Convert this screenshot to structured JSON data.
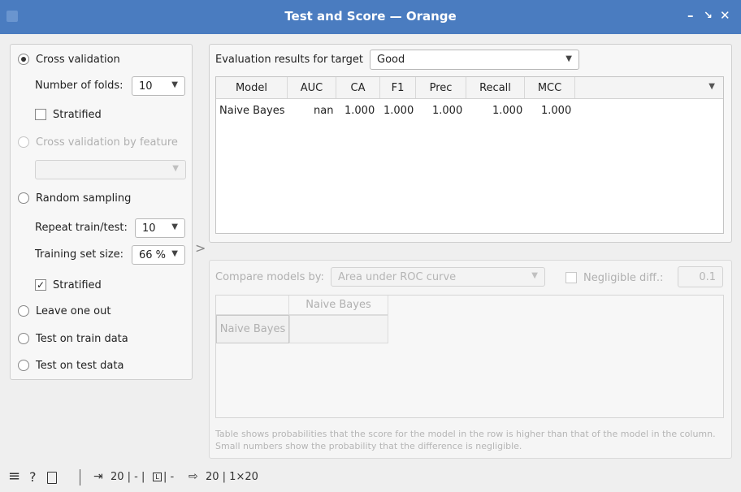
{
  "window": {
    "title": "Test and Score — Orange",
    "minimize_icon": "minimize-icon",
    "restore_icon": "restore-icon",
    "close_icon": "close-icon"
  },
  "sampling": {
    "cross_validation": "Cross validation",
    "number_of_folds_label": "Number of folds:",
    "number_of_folds_value": "10",
    "stratified_cv": "Stratified",
    "cv_by_feature": "Cross validation by feature",
    "random_sampling": "Random sampling",
    "repeat_label": "Repeat train/test:",
    "repeat_value": "10",
    "train_size_label": "Training set size:",
    "train_size_value": "66 %",
    "stratified_rs": "Stratified",
    "leave_one_out": "Leave one out",
    "test_on_train": "Test on train data",
    "test_on_test": "Test on test data",
    "selected": "Cross validation"
  },
  "results": {
    "target_label": "Evaluation results for target",
    "target_value": "Good",
    "columns": [
      "Model",
      "AUC",
      "CA",
      "F1",
      "Prec",
      "Recall",
      "MCC"
    ],
    "rows": [
      {
        "model": "Naive Bayes",
        "auc": "nan",
        "ca": "1.000",
        "f1": "1.000",
        "prec": "1.000",
        "recall": "1.000",
        "mcc": "1.000"
      }
    ]
  },
  "compare": {
    "label": "Compare models by:",
    "metric": "Area under ROC curve",
    "negligible_label": "Negligible diff.:",
    "negligible_value": "0.1",
    "col_header": "Naive Bayes",
    "row_header": "Naive Bayes",
    "footnote_1": "Table shows probabilities that the score for the model in the row is higher than that of the model in the column.",
    "footnote_2": "Small numbers show the probability that the difference is negligible."
  },
  "status": {
    "input_count": "20 | - | ",
    "input_sep": " | - ",
    "output_count": "20 | 1×20"
  },
  "icons": {
    "menu": "menu-icon",
    "help": "help-icon",
    "report": "report-icon",
    "input": "input-icon",
    "output": "output-icon"
  }
}
